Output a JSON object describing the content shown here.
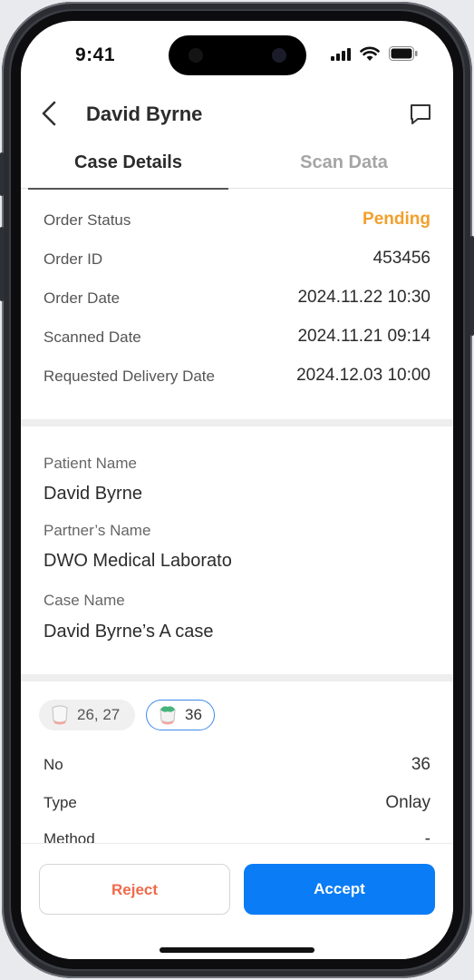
{
  "status_bar": {
    "time": "9:41"
  },
  "header": {
    "title": "David Byrne"
  },
  "tabs": [
    {
      "label": "Case Details",
      "active": true
    },
    {
      "label": "Scan Data",
      "active": false
    }
  ],
  "order_info": [
    {
      "label": "Order Status",
      "value": "Pending"
    },
    {
      "label": "Order ID",
      "value": "453456"
    },
    {
      "label": "Order Date",
      "value": "2024.11.22 10:30"
    },
    {
      "label": "Scanned Date",
      "value": "2024.11.21 09:14"
    },
    {
      "label": "Requested Delivery Date",
      "value": "2024.12.03 10:00"
    }
  ],
  "patient": {
    "patient_name_label": "Patient Name",
    "patient_name": "David Byrne",
    "partner_label": "Partner’s Name",
    "partner_name": "DWO Medical Laborato",
    "case_name_label": "Case Name",
    "case_name": "David Byrne’s A case"
  },
  "teeth_chips": [
    {
      "label": "26, 27",
      "selected": false,
      "icon": "crown-tooth-icon"
    },
    {
      "label": "36",
      "selected": true,
      "icon": "onlay-tooth-icon"
    }
  ],
  "details": [
    {
      "label": "No",
      "value": "36"
    },
    {
      "label": "Type",
      "value": "Onlay"
    },
    {
      "label": "Method",
      "value": "-"
    }
  ],
  "actions": {
    "reject": "Reject",
    "accept": "Accept"
  },
  "colors": {
    "pending": "#f2a02c",
    "accent": "#0a7cf5",
    "reject": "#f06a4a"
  }
}
